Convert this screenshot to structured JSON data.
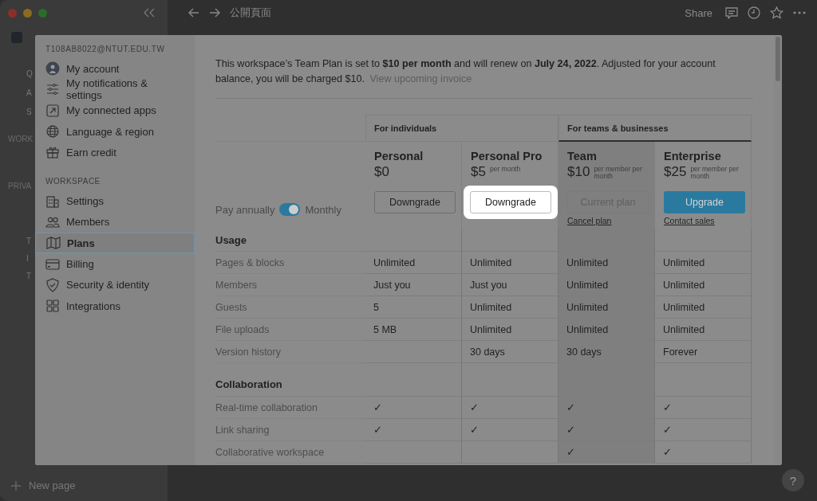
{
  "window": {
    "title": "公開頁面"
  },
  "topbar": {
    "share": "Share"
  },
  "background_sidebar": {
    "fragments": [
      "Q",
      "A",
      "S"
    ],
    "section_1": "WORK",
    "section_2": "PRIVA",
    "fragments_2": [
      "T",
      "I",
      "T"
    ],
    "new_page": "New page"
  },
  "help": "?",
  "settings_nav": {
    "account_email": "T108AB8022@NTUT.EDU.TW",
    "account_items": [
      {
        "label": "My account",
        "selected": false
      },
      {
        "label": "My notifications & settings",
        "selected": false
      },
      {
        "label": "My connected apps",
        "selected": false
      },
      {
        "label": "Language & region",
        "selected": false
      },
      {
        "label": "Earn credit",
        "selected": false
      }
    ],
    "workspace_heading": "WORKSPACE",
    "workspace_items": [
      {
        "label": "Settings",
        "selected": false
      },
      {
        "label": "Members",
        "selected": false
      },
      {
        "label": "Plans",
        "selected": true
      },
      {
        "label": "Billing",
        "selected": false
      },
      {
        "label": "Security & identity",
        "selected": false
      },
      {
        "label": "Integrations",
        "selected": false
      }
    ]
  },
  "notice": {
    "text": "This workspace’s Team Plan is set to **$10 per month** and will renew on **July 24, 2022**. Adjusted for your account balance, you will be charged $10.",
    "link": "View upcoming invoice"
  },
  "billing_toggle": {
    "left": "Pay annually",
    "right": "Monthly",
    "on": true
  },
  "plan_groups": [
    {
      "label": "For individuals",
      "selected": false
    },
    {
      "label": "For teams & businesses",
      "selected": true
    }
  ],
  "plans": [
    {
      "name": "Personal",
      "price": "$0",
      "current": false,
      "button": {
        "label": "Downgrade",
        "kind": "outline"
      }
    },
    {
      "name": "Personal Pro",
      "price": "$5",
      "period": "per month",
      "current": false,
      "button": {
        "label": "Downgrade",
        "kind": "highlight"
      }
    },
    {
      "name": "Team",
      "price": "$10",
      "period": "per member per month",
      "current": true,
      "button": {
        "label": "Current plan",
        "kind": "disabled"
      },
      "link": "Cancel plan"
    },
    {
      "name": "Enterprise",
      "price": "$25",
      "period": "per member per month",
      "current": false,
      "button": {
        "label": "Upgrade",
        "kind": "primary"
      },
      "link": "Contact sales"
    }
  ],
  "sections": [
    {
      "title": "Usage",
      "rows": [
        {
          "label": "Pages & blocks",
          "cells": [
            "Unlimited",
            "Unlimited",
            "Unlimited",
            "Unlimited"
          ]
        },
        {
          "label": "Members",
          "cells": [
            "Just you",
            "Just you",
            "Unlimited",
            "Unlimited"
          ]
        },
        {
          "label": "Guests",
          "cells": [
            "5",
            "Unlimited",
            "Unlimited",
            "Unlimited"
          ]
        },
        {
          "label": "File uploads",
          "cells": [
            "5 MB",
            "Unlimited",
            "Unlimited",
            "Unlimited"
          ]
        },
        {
          "label": "Version history",
          "cells": [
            "",
            "30 days",
            "30 days",
            "Forever"
          ]
        }
      ]
    },
    {
      "title": "Collaboration",
      "rows": [
        {
          "label": "Real-time collaboration",
          "cells": [
            "✓",
            "✓",
            "✓",
            "✓"
          ]
        },
        {
          "label": "Link sharing",
          "cells": [
            "✓",
            "✓",
            "✓",
            "✓"
          ]
        },
        {
          "label": "Collaborative workspace",
          "cells": [
            "",
            "",
            "✓",
            "✓"
          ]
        }
      ]
    }
  ]
}
